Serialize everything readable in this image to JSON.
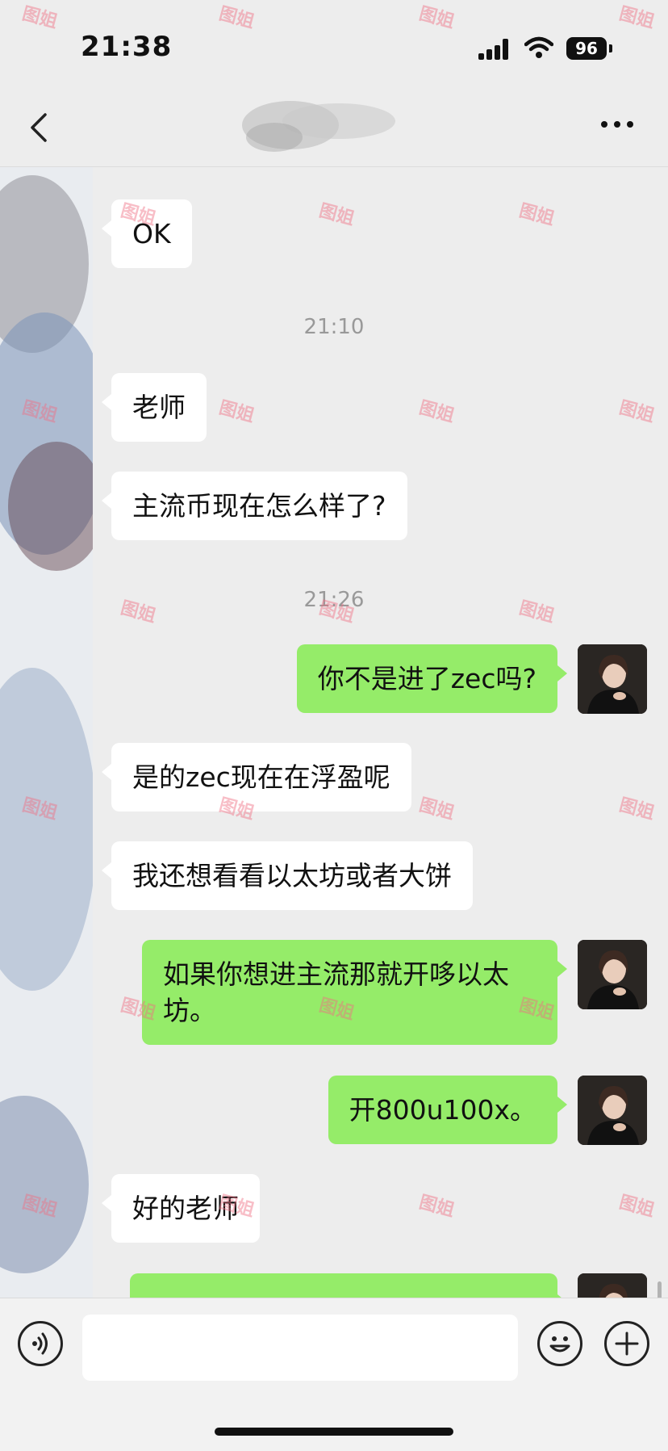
{
  "status_bar": {
    "time": "21:38",
    "battery": "96"
  },
  "nav": {
    "title": ""
  },
  "messages": [
    {
      "type": "in",
      "text": "OK"
    },
    {
      "type": "time",
      "text": "21:10"
    },
    {
      "type": "in",
      "text": "老师"
    },
    {
      "type": "in",
      "text": "主流币现在怎么样了?"
    },
    {
      "type": "time",
      "text": "21:26"
    },
    {
      "type": "out",
      "text": "你不是进了zec吗?"
    },
    {
      "type": "in",
      "text": "是的zec现在在浮盈呢"
    },
    {
      "type": "in",
      "text": "我还想看看以太坊或者大饼"
    },
    {
      "type": "out",
      "text": "如果你想进主流那就开哆以太坊。"
    },
    {
      "type": "out",
      "text": "开800u100x。"
    },
    {
      "type": "in",
      "text": "好的老师"
    }
  ],
  "input": {
    "placeholder": ""
  },
  "watermark": "图姐",
  "colors": {
    "outgoing_bubble": "#95ec69",
    "incoming_bubble": "#ffffff",
    "background": "#ededed"
  },
  "icons": [
    "back-icon",
    "more-icon",
    "voice-icon",
    "emoji-icon",
    "plus-icon",
    "wifi-icon",
    "signal-icon",
    "battery-icon"
  ]
}
